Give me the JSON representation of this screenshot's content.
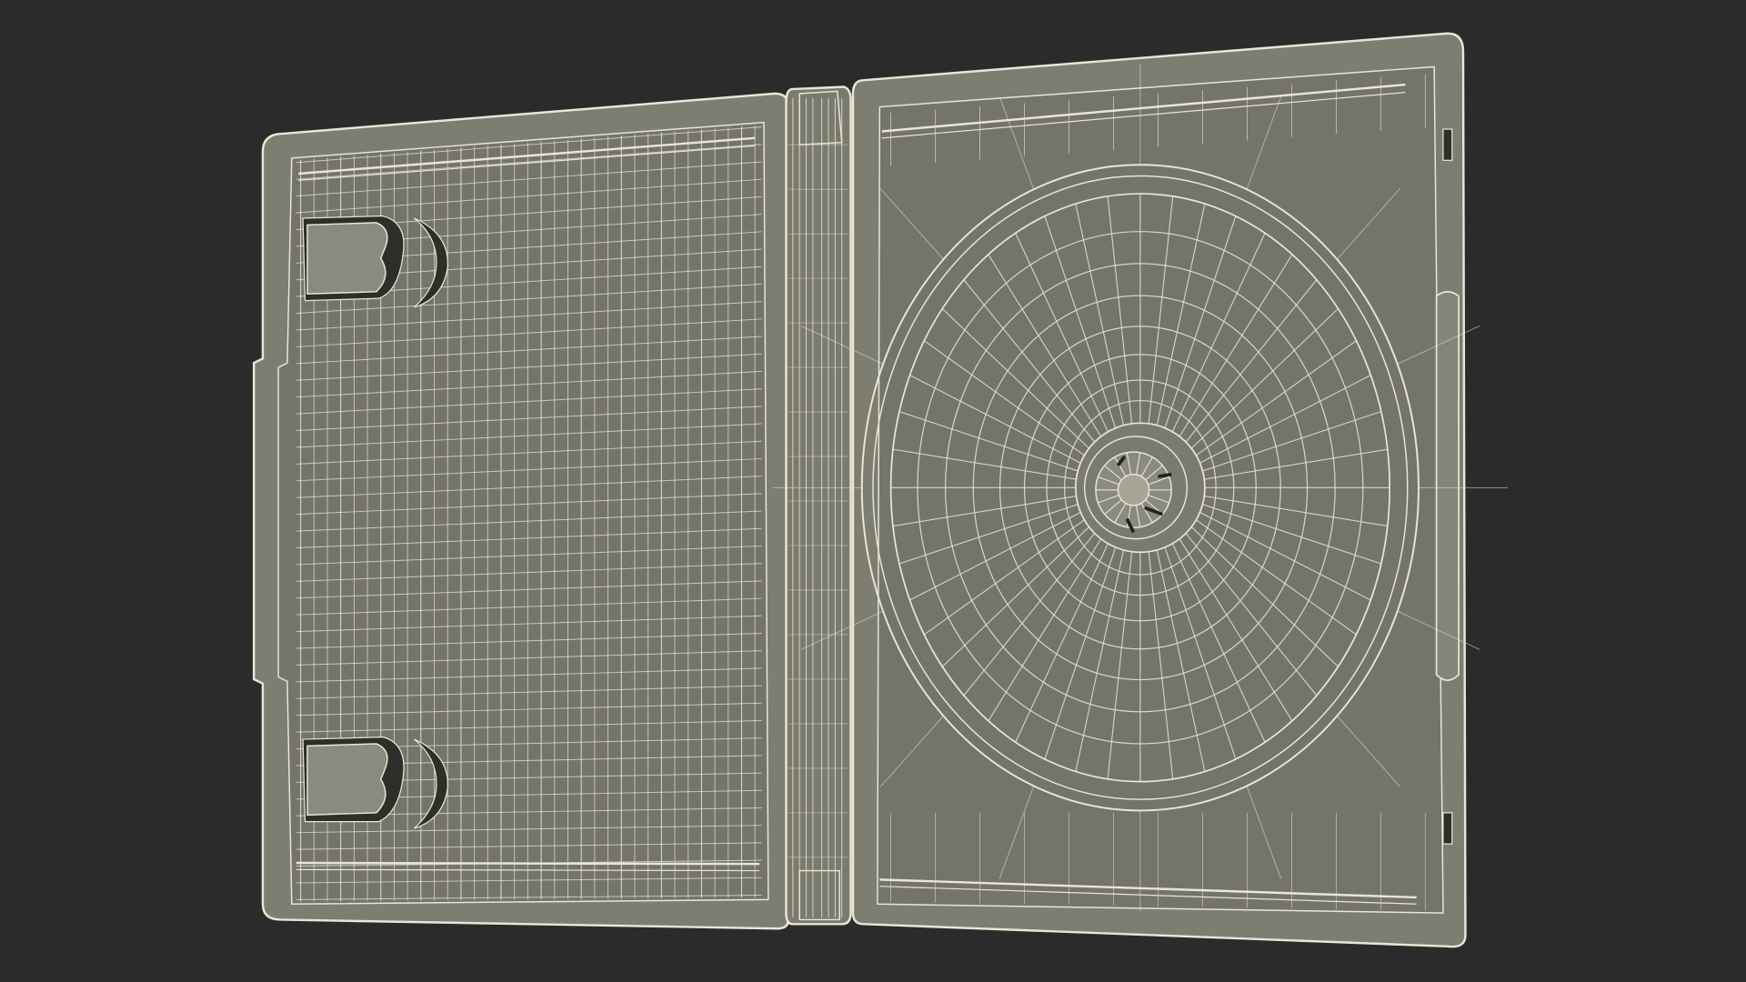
{
  "scene": {
    "subject": "open-disc-case-wireframe",
    "colors": {
      "background": "#2b2b2b",
      "plastic_fill": "#7d7d72",
      "plastic_fill_dark": "#6f6f65",
      "wire": "#e9e6d4",
      "wire_soft": "#cfcbb6",
      "shadow": "#3a3a34"
    },
    "parts": {
      "left_panel": "booklet-tray",
      "spine": "hinge-spine",
      "right_panel": "disc-tray",
      "hub": "center-hub"
    }
  }
}
